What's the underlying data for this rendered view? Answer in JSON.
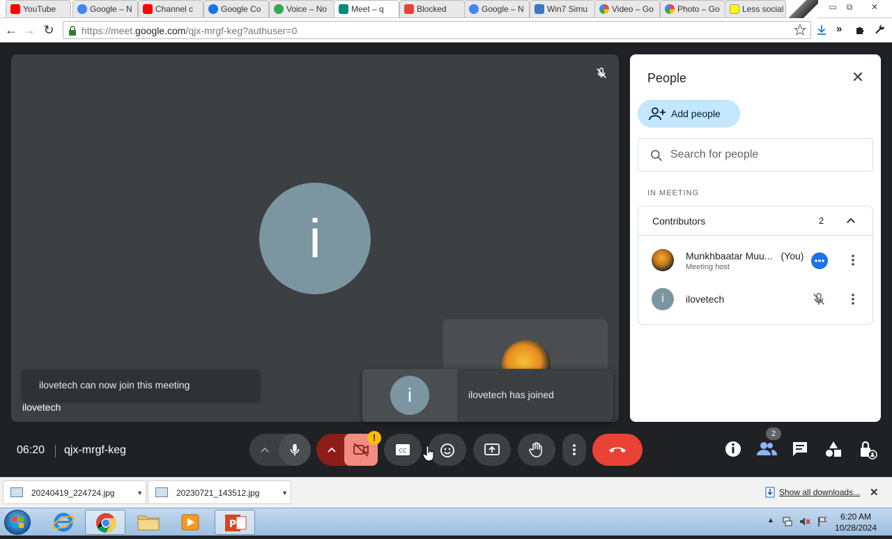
{
  "browser": {
    "tabs": [
      {
        "label": "YouTube",
        "favicon": "youtube-icon",
        "color": "#ff0000"
      },
      {
        "label": "Google – N",
        "favicon": "google-icon",
        "color": "#4285f4"
      },
      {
        "label": "Channel c",
        "favicon": "youtube-icon",
        "color": "#ff0000"
      },
      {
        "label": "Google Co",
        "favicon": "contacts-icon",
        "color": "#1a73e8"
      },
      {
        "label": "Voice – No",
        "favicon": "voice-icon",
        "color": "#34a853"
      },
      {
        "label": "Meet – q",
        "favicon": "meet-icon",
        "color": "#00897b"
      },
      {
        "label": "Blocked",
        "favicon": "gmail-icon",
        "color": "#ea4335"
      },
      {
        "label": "Google – N",
        "favicon": "google-icon",
        "color": "#4285f4"
      },
      {
        "label": "Win7 Simu",
        "favicon": "win7-icon",
        "color": "#3b78c3"
      },
      {
        "label": "Video – Go",
        "favicon": "photos-icon",
        "color": "#fbbc04"
      },
      {
        "label": "Photo – Go",
        "favicon": "photos-icon",
        "color": "#fbbc04"
      },
      {
        "label": "Less social",
        "favicon": "snapchat-icon",
        "color": "#fffc00"
      }
    ],
    "url_prefix": "https://meet.",
    "url_domain": "google.com",
    "url_path": "/qjx-mrgf-keg?authuser=0"
  },
  "meet": {
    "stage_avatar_letter": "i",
    "tile_name": "ilovetech",
    "join_notice": "ilovetech can now join this meeting",
    "toast_avatar_letter": "i",
    "toast_message": "ilovetech has joined",
    "clock": "06:20",
    "meeting_code": "qjx-mrgf-keg",
    "people_badge": "2",
    "warning_badge": "!"
  },
  "people_panel": {
    "title": "People",
    "add_people_label": "Add people",
    "search_placeholder": "Search for people",
    "in_meeting_label": "IN MEETING",
    "contributors_label": "Contributors",
    "contributors_count": "2",
    "participants": [
      {
        "name": "Munkhbaatar Muu...",
        "you_tag": "(You)",
        "role": "Meeting host",
        "status_color": "#1a73e8"
      },
      {
        "name": "ilovetech",
        "avatar_letter": "i",
        "avatar_color": "#7c96a1"
      }
    ]
  },
  "downloads": {
    "files": [
      "20240419_224724.jpg",
      "20230721_143512.jpg"
    ],
    "show_all_label": "Show all downloads..."
  },
  "taskbar": {
    "time": "6:20 AM",
    "date": "10/28/2024"
  },
  "colors": {
    "end_call": "#ea4335",
    "camera_off": "#f28b82",
    "add_people_bg": "#c2e7ff"
  }
}
